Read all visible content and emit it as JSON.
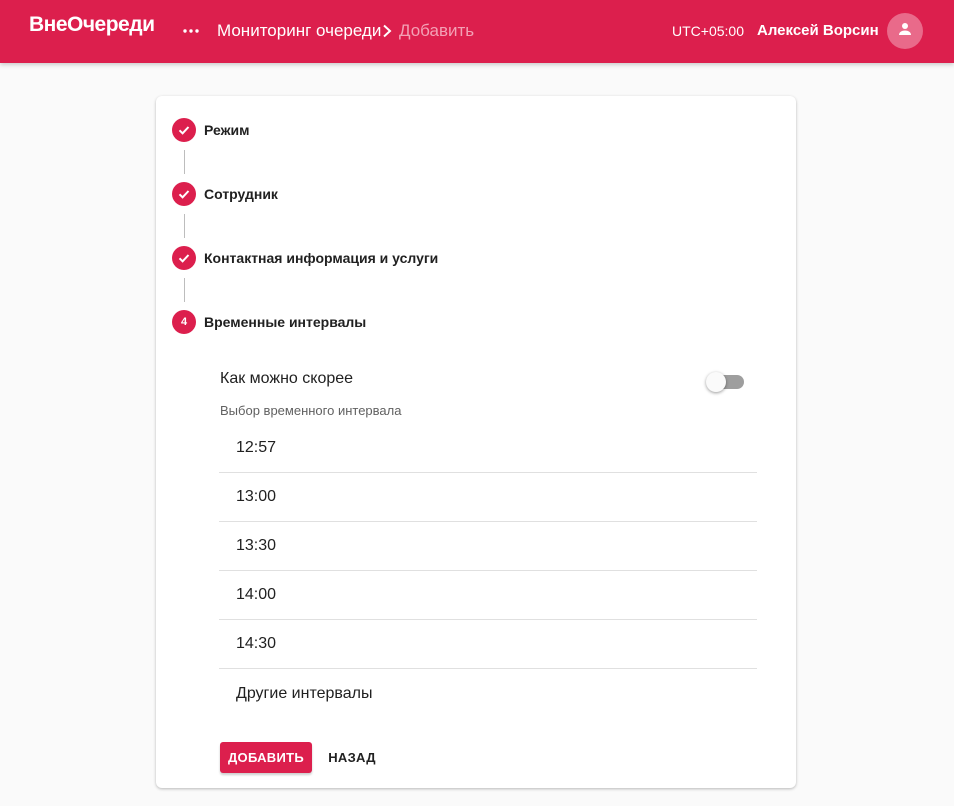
{
  "appbar": {
    "logo": "ВнеОчереди",
    "more_icon": "more-horiz-icon",
    "breadcrumb": {
      "current": "Мониторинг очереди",
      "separator_icon": "chevron-right-icon",
      "next": "Добавить"
    },
    "timezone": "UTC+05:00",
    "user_name": "Алексей Ворсин",
    "avatar_icon": "person-icon",
    "brand_color": "#dc1f4d"
  },
  "stepper": {
    "steps": [
      {
        "label": "Режим",
        "status": "completed",
        "icon": "check-icon"
      },
      {
        "label": "Сотрудник",
        "status": "completed",
        "icon": "check-icon"
      },
      {
        "label": "Контактная информация и услуги",
        "status": "completed",
        "icon": "check-icon"
      },
      {
        "label": "Временные интервалы",
        "status": "active",
        "number": "4"
      }
    ]
  },
  "time_step": {
    "asap_label": "Как можно скорее",
    "asap_enabled": false,
    "interval_caption": "Выбор временного интервала",
    "intervals": [
      "12:57",
      "13:00",
      "13:30",
      "14:00",
      "14:30",
      "Другие интервалы"
    ]
  },
  "actions": {
    "add_label": "ДОБАВИТЬ",
    "back_label": "НАЗАД"
  }
}
